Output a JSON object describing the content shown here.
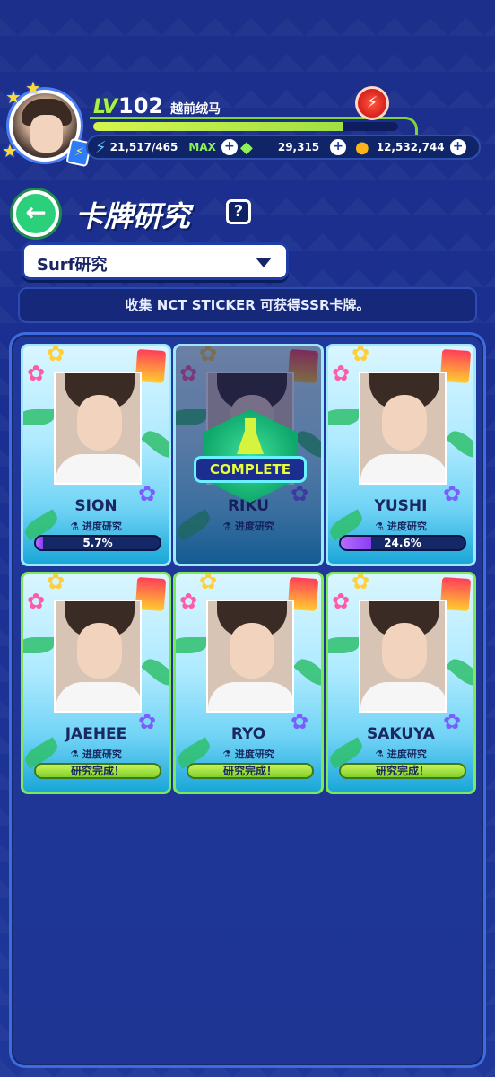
{
  "player": {
    "level_tag": "LV",
    "level": "102",
    "name": "越前绒马",
    "xp_fraction": 0.82
  },
  "resources": {
    "stamina": "21,517/465",
    "stamina_max": "MAX",
    "gems": "29,315",
    "coins": "12,532,744"
  },
  "page": {
    "title": "卡牌研究",
    "help": "?"
  },
  "dropdown": {
    "selected": "Surf研究"
  },
  "banner": {
    "text": "收集 NCT STICKER 可获得SSR卡牌。"
  },
  "labels": {
    "research": "进度研究",
    "done": "研究完成！",
    "complete": "COMPLETE"
  },
  "cards": [
    {
      "name": "SION",
      "status": "progress",
      "progress_text": "5.7%",
      "progress": 0.057
    },
    {
      "name": "RIKU",
      "status": "complete"
    },
    {
      "name": "YUSHI",
      "status": "progress",
      "progress_text": "24.6%",
      "progress": 0.246
    },
    {
      "name": "JAEHEE",
      "status": "done"
    },
    {
      "name": "RYO",
      "status": "done"
    },
    {
      "name": "SAKUYA",
      "status": "done"
    }
  ],
  "colors": {
    "background": "#1c2f8a",
    "accent_green": "#7fd43c",
    "progress_purple": "#9b55f8"
  }
}
